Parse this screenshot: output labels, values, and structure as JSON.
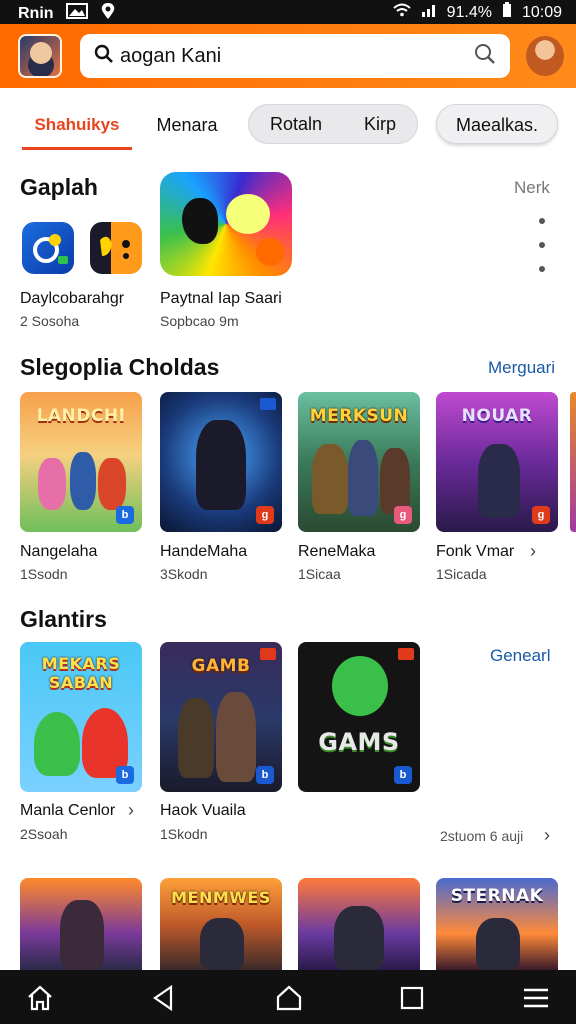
{
  "status_bar": {
    "left_text": "Rnin",
    "battery": "91.4%",
    "time": "10:09"
  },
  "search": {
    "query": "aogan Kani"
  },
  "tabs": {
    "active": "Shahuikys",
    "plain": "Menara",
    "pill_items": [
      "Rotaln",
      "Kirp"
    ],
    "pill_right": "Maealkas."
  },
  "section1": {
    "title": "Gaplah",
    "link": "Nerk",
    "item1": {
      "label": "Daylcobarahgr",
      "sub": "2 Sosoha"
    },
    "item2": {
      "label": "Paytnal Iap Saari",
      "sub": "Sopbcao 9m"
    }
  },
  "section2": {
    "title": "Slegoplia Choldas",
    "link": "Merguari",
    "tiles": [
      {
        "art": "LANDCHI",
        "label": "Nangelaha",
        "sub": "1Ssodn"
      },
      {
        "art": "",
        "label": "HandeMaha",
        "sub": "3Skodn"
      },
      {
        "art": "MERKSUN",
        "label": "ReneMaka",
        "sub": "1Sicaa"
      },
      {
        "art": "NOUAR",
        "label": "Fonk Vmar",
        "sub": "1Sicada"
      }
    ]
  },
  "section3": {
    "title": "Glantirs",
    "link": "Genearl",
    "tiles": [
      {
        "art": "MEKARS SABAN",
        "label": "Manla Cenlor",
        "sub": "2Ssoah"
      },
      {
        "art": "GAMB",
        "label": "Haok Vuaila",
        "sub": "1Skodn"
      },
      {
        "art": "GAMS",
        "label": "",
        "sub": ""
      }
    ],
    "footer": "2stuom 6 auji"
  },
  "section4": {
    "tiles": [
      {
        "art": ""
      },
      {
        "art": "MENMWES"
      },
      {
        "art": ""
      },
      {
        "art": "STERNAK"
      }
    ]
  },
  "icons": {
    "search": "search-icon",
    "home": "home-icon",
    "back": "back-icon",
    "menu": "menu-icon"
  },
  "colors": {
    "accent": "#e8451f",
    "header": "#ff7a10",
    "link": "#1a5aa8"
  }
}
